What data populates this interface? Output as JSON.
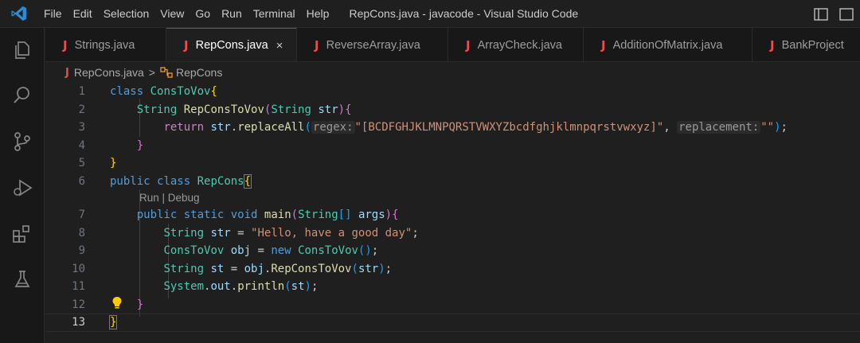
{
  "menu": [
    "File",
    "Edit",
    "Selection",
    "View",
    "Go",
    "Run",
    "Terminal",
    "Help"
  ],
  "window_title": "RepCons.java - javacode - Visual Studio Code",
  "tabs": [
    {
      "label": "Strings.java",
      "active": false
    },
    {
      "label": "RepCons.java",
      "active": true
    },
    {
      "label": "ReverseArray.java",
      "active": false
    },
    {
      "label": "ArrayCheck.java",
      "active": false
    },
    {
      "label": "AdditionOfMatrix.java",
      "active": false
    },
    {
      "label": "BankProject",
      "active": false
    }
  ],
  "tab_icon_letter": "J",
  "tab_close_glyph": "×",
  "breadcrumb": {
    "file": "RepCons.java",
    "separator": ">",
    "symbol": "RepCons"
  },
  "codelens": "Run | Debug",
  "line_numbers": [
    "1",
    "2",
    "3",
    "4",
    "5",
    "6",
    "7",
    "8",
    "9",
    "10",
    "11",
    "12",
    "13"
  ],
  "code": {
    "l1": {
      "kw": "class",
      "name": "ConsToVov",
      "br": "{"
    },
    "l2": {
      "type": "String",
      "fn": "RepConsToVov",
      "p_open": "(",
      "p_type": "String",
      "p_var": "str",
      "p_close": ")",
      "br": "{"
    },
    "l3": {
      "ret": "return",
      "var": "str",
      "dot": ".",
      "fn": "replaceAll",
      "p_open": "(",
      "hint1": "regex:",
      "str1": "\"[BCDFGHJKLMNPQRSTVWXYZbcdfghjklmnpqrstvwxyz]\"",
      "comma": ", ",
      "hint2": "replacement:",
      "str2": "\"\"",
      "p_close": ")",
      "semi": ";"
    },
    "l4": {
      "br": "}"
    },
    "l5": {
      "br": "}"
    },
    "l6": {
      "kw1": "public",
      "kw2": "class",
      "name": "RepCons",
      "br": "{"
    },
    "l7": {
      "kw1": "public",
      "kw2": "static",
      "kw3": "void",
      "fn": "main",
      "p_open": "(",
      "p_type": "String",
      "arr": "[]",
      "p_var": "args",
      "p_close": ")",
      "br": "{"
    },
    "l8": {
      "type": "String",
      "var": "str",
      "eq": " = ",
      "str": "\"Hello, have a good day\"",
      "semi": ";"
    },
    "l9": {
      "type": "ConsToVov",
      "var": "obj",
      "eq": " = ",
      "new": "new",
      "cls": "ConsToVov",
      "parens": "()",
      "semi": ";"
    },
    "l10": {
      "type": "String",
      "var": "st",
      "eq": " = ",
      "obj": "obj",
      "dot": ".",
      "fn": "RepConsToVov",
      "p_open": "(",
      "arg": "str",
      "p_close": ")",
      "semi": ";"
    },
    "l11": {
      "sys": "System",
      "dot1": ".",
      "out": "out",
      "dot2": ".",
      "fn": "println",
      "p_open": "(",
      "arg": "st",
      "p_close": ")",
      "semi": ";"
    },
    "l12": {
      "br": "}"
    },
    "l13": {
      "br": "}"
    }
  },
  "colors": {
    "accent": "#0078d4",
    "java_icon": "#f14c4c",
    "keyword": "#569cd6",
    "type": "#4ec9b0",
    "function": "#dcdcaa",
    "string": "#ce9178",
    "variable": "#9cdcfe"
  }
}
